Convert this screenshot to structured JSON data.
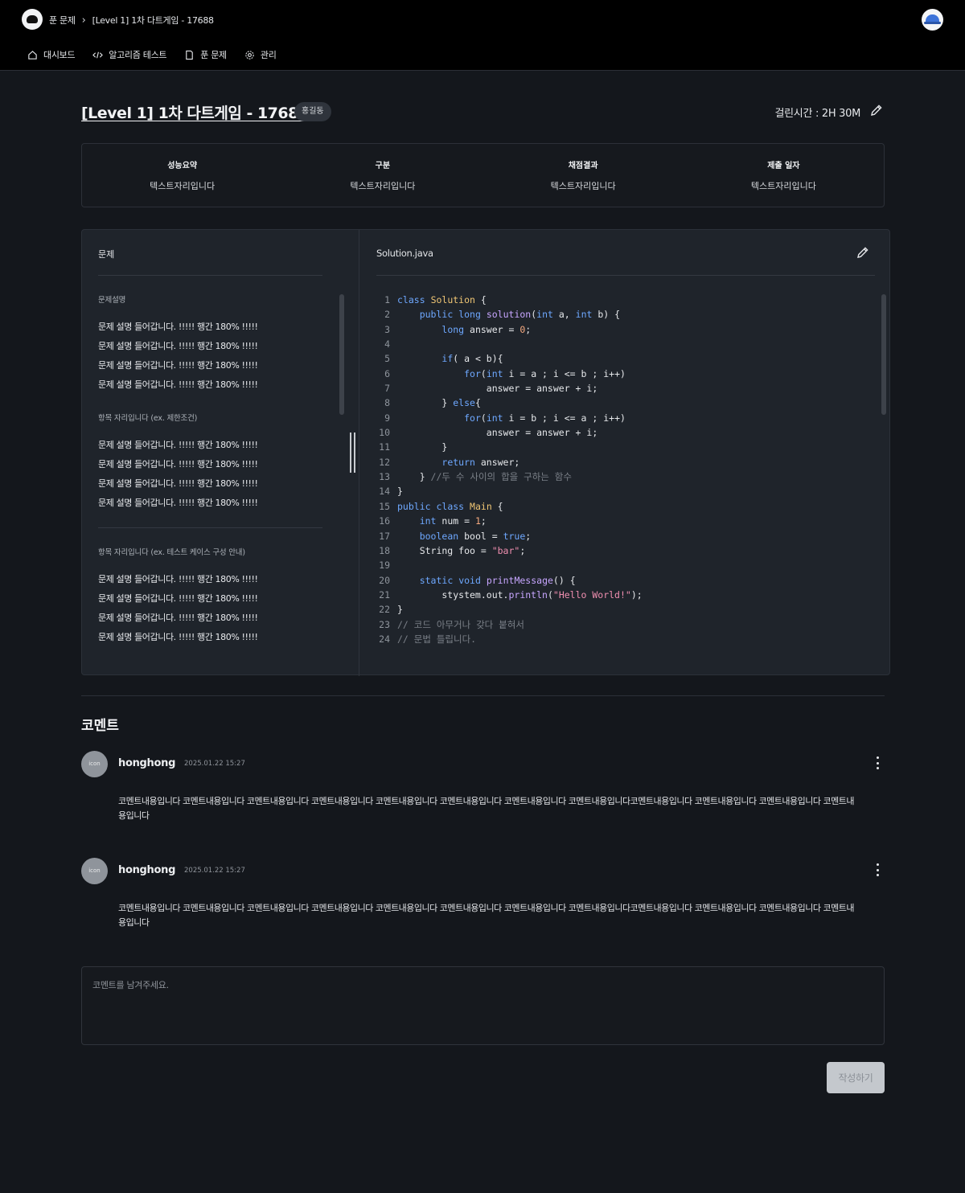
{
  "header": {
    "breadcrumbs": [
      "푼 문제",
      "[Level 1] 1차 다트게임 - 17688"
    ],
    "nav": [
      {
        "label": "대시보드",
        "icon": "home-icon"
      },
      {
        "label": "알고리즘 테스트",
        "icon": "code-icon"
      },
      {
        "label": "푼 문제",
        "icon": "document-icon"
      },
      {
        "label": "관리",
        "icon": "gear-icon"
      }
    ]
  },
  "problem": {
    "title": "[Level 1] 1차 다트게임 - 17688",
    "author_badge": "홍길동",
    "elapsed": "걸린시간 : 2H 30M"
  },
  "summary": [
    {
      "label": "성능요약",
      "value": "텍스트자리입니다"
    },
    {
      "label": "구분",
      "value": "텍스트자리입니다"
    },
    {
      "label": "채점결과",
      "value": "텍스트자리입니다"
    },
    {
      "label": "제출 일자",
      "value": "텍스트자리입니다"
    }
  ],
  "left_pane": {
    "heading": "문제",
    "sections": [
      {
        "title": "문제설명",
        "lines": [
          "문제 설명 들어갑니다. !!!!! 행간 180% !!!!!",
          "문제 설명 들어갑니다. !!!!! 행간 180% !!!!!",
          "문제 설명 들어갑니다. !!!!! 행간 180% !!!!!",
          "문제 설명 들어갑니다. !!!!! 행간 180% !!!!!"
        ]
      },
      {
        "title": "항목 자리입니다 (ex. 제한조건)",
        "lines": [
          "문제 설명 들어갑니다. !!!!! 행간 180% !!!!!",
          "문제 설명 들어갑니다. !!!!! 행간 180% !!!!!",
          "문제 설명 들어갑니다. !!!!! 행간 180% !!!!!",
          "문제 설명 들어갑니다. !!!!! 행간 180% !!!!!"
        ]
      },
      {
        "title": "항목 자리입니다 (ex. 테스트 케이스 구성 안내)",
        "lines": [
          "문제 설명 들어갑니다. !!!!! 행간 180% !!!!!",
          "문제 설명 들어갑니다. !!!!! 행간 180% !!!!!",
          "문제 설명 들어갑니다. !!!!! 행간 180% !!!!!",
          "문제 설명 들어갑니다. !!!!! 행간 180% !!!!!"
        ]
      }
    ]
  },
  "code": {
    "file_name": "Solution.java",
    "lines": [
      "class Solution {",
      "    public long solution(int a, int b) {",
      "        long answer = 0;",
      "",
      "        if( a < b){",
      "            for(int i = a ; i <= b ; i++)",
      "                answer = answer + i;",
      "        } else{",
      "            for(int i = b ; i <= a ; i++)",
      "                answer = answer + i;",
      "        }",
      "        return answer;",
      "    } //두 수 사이의 합을 구하는 함수",
      "}",
      "public class Main {",
      "    int num = 1;",
      "    boolean bool = true;",
      "    String foo = \"bar\";",
      "",
      "    static void printMessage() {",
      "        stystem.out.println(\"Hello World!\");",
      "}",
      "// 코드 아무거나 갖다 붙혀서",
      "// 문법 틀립니다."
    ]
  },
  "comments": {
    "title": "코멘트",
    "items": [
      {
        "avatar_text": "icon",
        "author": "honghong",
        "date": "2025.01.22 15:27",
        "body": "코멘트내용입니다 코멘트내용입니다 코멘트내용입니다 코멘트내용입니다 코멘트내용입니다 코멘트내용입니다 코멘트내용입니다 코멘트내용입니다코멘트내용입니다 코멘트내용입니다 코멘트내용입니다 코멘트내용입니다"
      },
      {
        "avatar_text": "icon",
        "author": "honghong",
        "date": "2025.01.22 15:27",
        "body": "코멘트내용입니다 코멘트내용입니다 코멘트내용입니다 코멘트내용입니다 코멘트내용입니다 코멘트내용입니다 코멘트내용입니다 코멘트내용입니다코멘트내용입니다 코멘트내용입니다 코멘트내용입니다 코멘트내용입니다"
      }
    ],
    "input_placeholder": "코멘트를 남겨주세요.",
    "submit_label": "작성하기"
  }
}
